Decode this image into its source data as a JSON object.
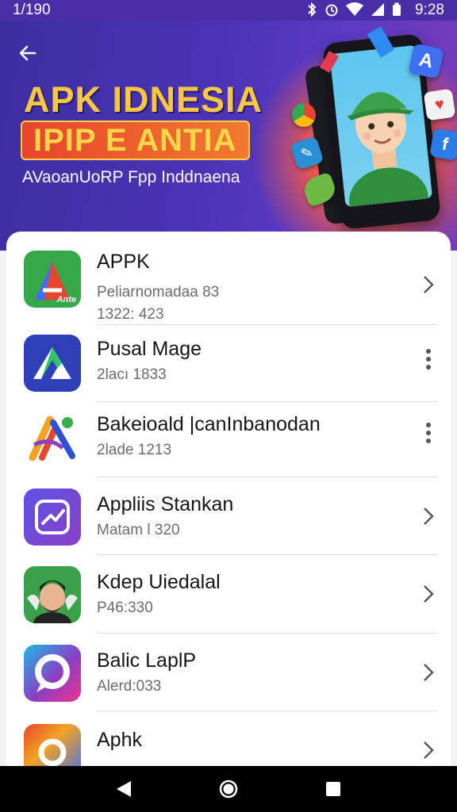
{
  "status_bar": {
    "left_text": "1/190",
    "time": "9:28",
    "icons": [
      "bluetooth-icon",
      "alarm-icon",
      "wifi-icon",
      "signal-icon",
      "battery-icon"
    ]
  },
  "hero": {
    "title": "APK IDNESIA",
    "badge": "IPIP E ANTIA",
    "subtitle": "AVaoanUoRP Fpp Inddnaena",
    "float_icons": [
      "A",
      "f"
    ]
  },
  "apps": [
    {
      "name": "APPK",
      "meta1": "Peliarnomadaa 83",
      "meta2": "1322: 423",
      "action": "chevron-right",
      "icon_label": "Ante"
    },
    {
      "name": "Pusal Mage",
      "meta1": "2lacı 1833",
      "meta2": "",
      "action": "more-vert",
      "icon_label": ""
    },
    {
      "name": "Bakeioald |canInbanodan",
      "meta1": "2lade 1213",
      "meta2": "",
      "action": "more-vert",
      "icon_label": ""
    },
    {
      "name": "Appliis Stankan",
      "meta1": "Matam l 320",
      "meta2": "",
      "action": "chevron-right",
      "icon_label": ""
    },
    {
      "name": "Kdep Uiedalal",
      "meta1": "P46:330",
      "meta2": "",
      "action": "chevron-right",
      "icon_label": ""
    },
    {
      "name": "Balic LaplP",
      "meta1": "Alerd:033",
      "meta2": "",
      "action": "chevron-right",
      "icon_label": ""
    },
    {
      "name": "Aphk",
      "meta1": "",
      "meta2": "",
      "action": "chevron-right",
      "icon_label": ""
    }
  ],
  "colors": {
    "hero_bg": "#4a33b5",
    "title_yellow": "#f7c744",
    "badge_red": "#e8452d",
    "text_dark": "#151515",
    "text_muted": "#6c6c6c"
  }
}
